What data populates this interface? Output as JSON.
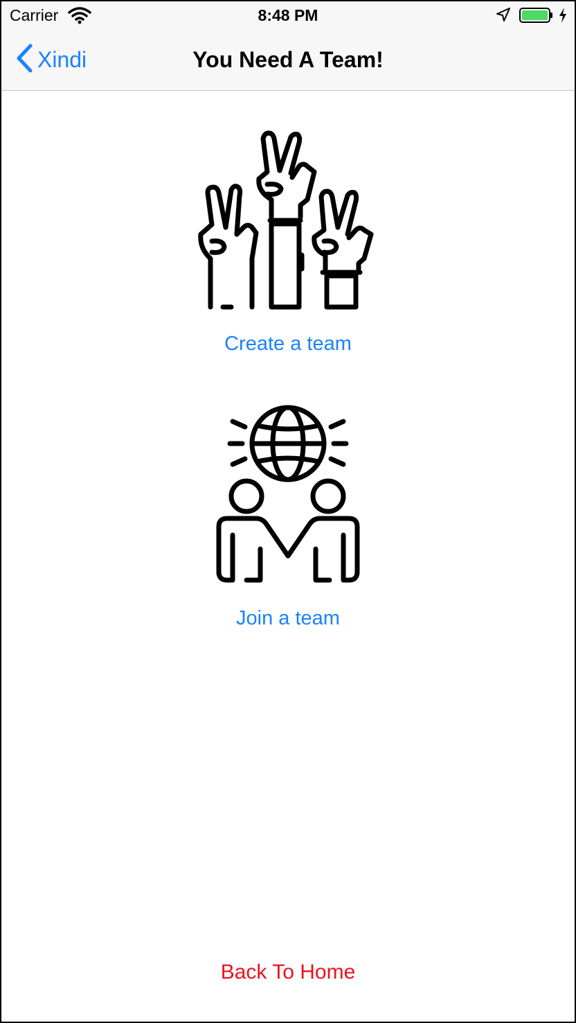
{
  "status_bar": {
    "carrier": "Carrier",
    "time": "8:48 PM",
    "battery_color": "#4cd964"
  },
  "nav": {
    "back_label": "Xindi",
    "title": "You Need A Team!"
  },
  "options": {
    "create_label": "Create a team",
    "join_label": "Join a team"
  },
  "footer": {
    "back_home_label": "Back To Home"
  },
  "colors": {
    "accent": "#1a82fb",
    "destructive": "#e8141e"
  }
}
